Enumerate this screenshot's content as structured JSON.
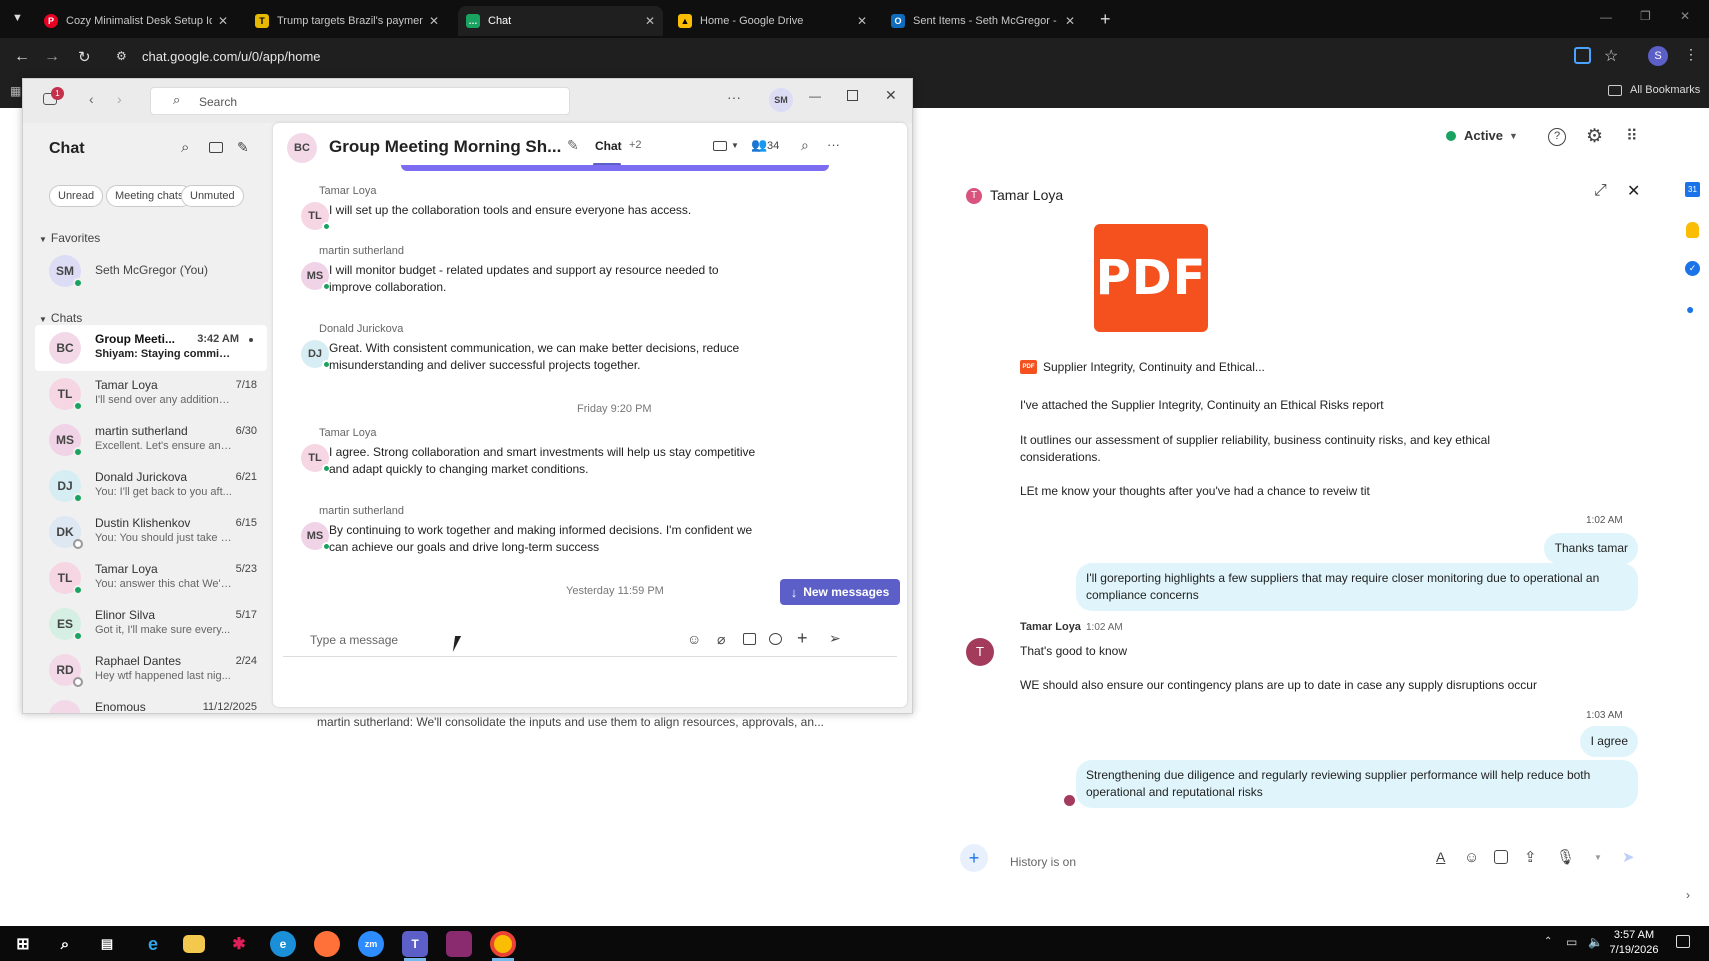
{
  "browser": {
    "tabs": [
      {
        "title": "Cozy Minimalist Desk Setup Ide",
        "icon": "pinterest-icon",
        "color": "#e60023"
      },
      {
        "title": "Trump targets Brazil's payment",
        "icon": "news-icon",
        "color": "#e6b800"
      },
      {
        "title": "Chat",
        "icon": "google-chat-icon",
        "color": "#1aa260"
      },
      {
        "title": "Home - Google Drive",
        "icon": "google-drive-icon",
        "color": "#fbbc04"
      },
      {
        "title": "Sent Items - Seth McGregor - C",
        "icon": "outlook-icon",
        "color": "#0f6cbd"
      }
    ],
    "url": "chat.google.com/u/0/app/home",
    "bookmarks_label": "All Bookmarks",
    "profile_initial": "S"
  },
  "gchat": {
    "status": "Active",
    "profile_initial": "S",
    "dm_title": "Tamar Loya",
    "dm_initial": "T",
    "pdf_label": "PDF",
    "attachment_name": "Supplier Integrity, Continuity and Ethical...",
    "messages_in": [
      "I've attached the Supplier Integrity, Continuity an Ethical Risks report",
      "It outlines our assessment of supplier reliability, business continuity risks, and key ethical considerations.",
      "LEt me know your thoughts after you've had a chance to reveiw tit"
    ],
    "time_1": "1:02 AM",
    "out_1": "Thanks tamar",
    "out_2": "I'll goreporting highlights a few suppliers that may require closer monitoring due to operational an compliance concerns",
    "reply_sender": "Tamar Loya",
    "reply_time": "1:02 AM",
    "reply_1": "That's good to know",
    "reply_2": "WE should also ensure our contingency plans are up to date in case any supply disruptions occur",
    "time_2": "1:03 AM",
    "out_3": "I agree",
    "out_4": "Strengthening due diligence and regularly reviewing supplier performance will help reduce both operational and reputational risks",
    "composer_placeholder": "History is on",
    "bg_preview": "martin sutherland: We'll consolidate the inputs and use them to align resources, approvals, an..."
  },
  "teams": {
    "notif_count": "1",
    "search_placeholder": "Search",
    "user_initials": "SM",
    "left_title": "Chat",
    "filters": [
      "Unread",
      "Meeting chats",
      "Unmuted"
    ],
    "favorites_label": "Favorites",
    "favorite": {
      "initials": "SM",
      "name": "Seth McGregor (You)"
    },
    "chats_label": "Chats",
    "chats": [
      {
        "initials": "BC",
        "name": "Group Meeti...",
        "date": "3:42 AM",
        "preview": "Shiyam: Staying committ...",
        "bg": "#f3d9e8"
      },
      {
        "initials": "TL",
        "name": "Tamar Loya",
        "date": "7/18",
        "preview": "I'll send over any additiona...",
        "bg": "#f6d6e3"
      },
      {
        "initials": "MS",
        "name": "martin sutherland",
        "date": "6/30",
        "preview": "Excellent. Let's ensure any ...",
        "bg": "#f0d3e6"
      },
      {
        "initials": "DJ",
        "name": "Donald Juricko­va",
        "date": "6/21",
        "preview": "You: I'll get back to you aft...",
        "bg": "#d6eef3"
      },
      {
        "initials": "DK",
        "name": "Dustin Klishenkov",
        "date": "6/15",
        "preview": "You: You should just take y...",
        "bg": "#dde8f3"
      },
      {
        "initials": "TL",
        "name": "Tamar Loya",
        "date": "5/23",
        "preview": "You: answer this chat We'll...",
        "bg": "#f6d6e3"
      },
      {
        "initials": "ES",
        "name": "Elinor Silva",
        "date": "5/17",
        "preview": "Got it, I'll make sure every...",
        "bg": "#d5efe4"
      },
      {
        "initials": "RD",
        "name": "Raphael Dantes",
        "date": "2/24",
        "preview": "Hey wtf happened last nig...",
        "bg": "#f3d9e8"
      },
      {
        "initials": "",
        "name": "Enomous",
        "date": "11/12/2025",
        "preview": "",
        "bg": "#f3d9e8"
      }
    ],
    "group_initials": "BC",
    "group_title": "Group Meeting Morning Sh...",
    "tab_chat": "Chat",
    "tab_more": "+2",
    "participants": "34",
    "messages": [
      {
        "sender": "Tamar Loya",
        "initials": "TL",
        "text": "I will set up the collaboration tools and ensure everyone has access.",
        "bg": "#f6d6e3"
      },
      {
        "sender": "martin sutherland",
        "initials": "MS",
        "text": "I will monitor budget - related updates and support ay resource needed to improve collaboration.",
        "bg": "#f0d3e6"
      },
      {
        "sender": "Donald Jurickova",
        "initials": "DJ",
        "text": "Great. With consistent communication, we can make better decisions, reduce misunderstanding and deliver successful projects together.",
        "bg": "#d6eef3"
      },
      {
        "sender": "Tamar Loya",
        "initials": "TL",
        "text": "I agree. Strong collaboration and smart investments will help us stay competitive and adapt quickly to changing market conditions.",
        "bg": "#f6d6e3"
      },
      {
        "sender": "martin sutherland",
        "initials": "MS",
        "text": "By continuing to work together and making informed decisions. I'm confident we can achieve our goals and drive long-term success",
        "bg": "#f0d3e6"
      }
    ],
    "ts_friday": "Friday 9:20 PM",
    "ts_yesterday": "Yesterday 11:59 PM",
    "new_messages": "New messages",
    "compose_placeholder": "Type a message"
  },
  "taskbar": {
    "time": "3:57 AM",
    "date": "7/19/2026"
  }
}
